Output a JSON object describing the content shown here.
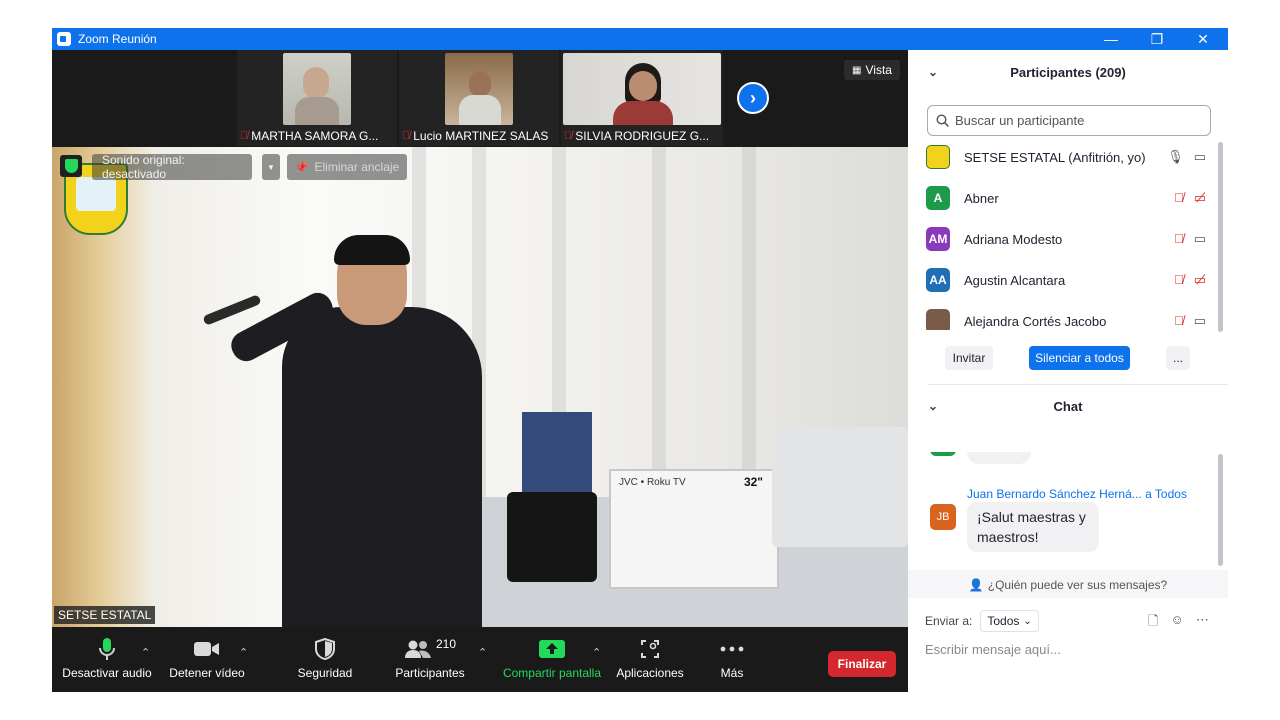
{
  "window": {
    "title": "Zoom Reunión",
    "controls": {
      "minimize": "—",
      "restore": "❐",
      "close": "✕"
    }
  },
  "strip": {
    "thumbs": [
      {
        "name": "MARTHA SAMORA G..."
      },
      {
        "name": "Lucio MARTINEZ SALAS"
      },
      {
        "name": "SILVIA RODRIGUEZ G..."
      }
    ],
    "view_label": "Vista"
  },
  "video": {
    "audio_btn_label": "Sonido original: desactivado",
    "unpin_label": "Eliminar anclaje",
    "caption": "SETSE ESTATAL",
    "tv_brand": "JVC • Roku TV",
    "tv_size": "32\""
  },
  "toolbar": {
    "mute_label": "Desactivar audio",
    "video_label": "Detener vídeo",
    "security_label": "Seguridad",
    "participants_label": "Participantes",
    "participants_count": "210",
    "share_label": "Compartir pantalla",
    "apps_label": "Aplicaciones",
    "more_label": "Más",
    "end_label": "Finalizar"
  },
  "participants": {
    "title": "Participantes (209)",
    "search_placeholder": "Buscar un participante",
    "items": [
      {
        "initials": "",
        "name": "SETSE ESTATAL (Anfitrión, yo)",
        "color": "#f2d21a"
      },
      {
        "initials": "A",
        "name": "Abner",
        "color": "#1d9b48"
      },
      {
        "initials": "AM",
        "name": "Adriana Modesto",
        "color": "#8a3ab9"
      },
      {
        "initials": "AA",
        "name": "Agustin Alcantara",
        "color": "#1e6fb5"
      },
      {
        "initials": "",
        "name": "Alejandra Cortés Jacobo",
        "color": "#7a5a48"
      }
    ],
    "invite_label": "Invitar",
    "mute_all_label": "Silenciar a todos",
    "more_label": "..."
  },
  "chat": {
    "title": "Chat",
    "sender": "Juan Bernardo Sánchez Herná...",
    "to": "a Todos",
    "initials": "JB",
    "message": "¡Salut maestras y maestros!",
    "who_can_see": "¿Quién puede ver sus mensajes?",
    "send_to_label": "Enviar a:",
    "send_to_value": "Todos",
    "compose_placeholder": "Escribir mensaje aquí..."
  }
}
